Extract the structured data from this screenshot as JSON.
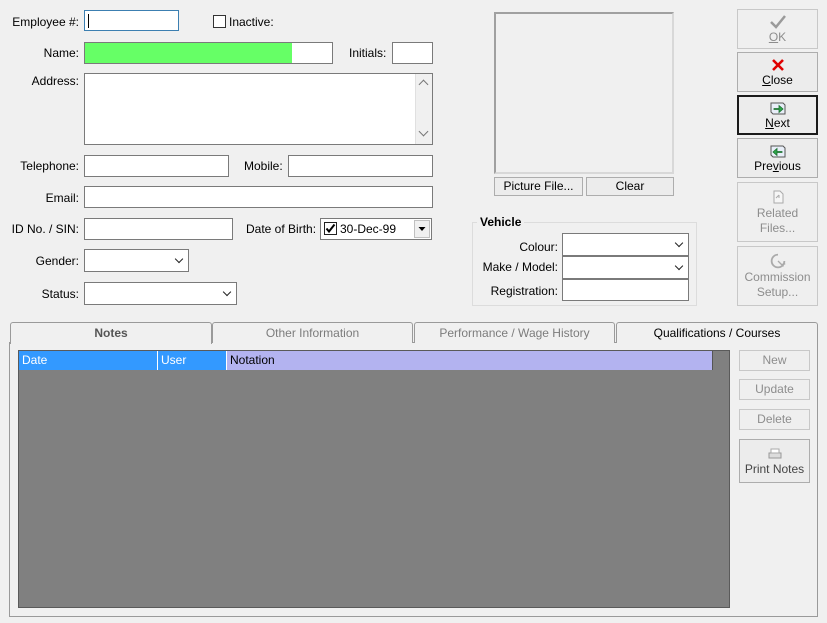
{
  "form": {
    "employee_no_label": "Employee #:",
    "employee_no_value": "",
    "inactive_label": "Inactive:",
    "inactive_checked": false,
    "name_label": "Name:",
    "name_value": "",
    "name_progress": 0.84,
    "initials_label": "Initials:",
    "initials_value": "",
    "address_label": "Address:",
    "address_value": "",
    "telephone_label": "Telephone:",
    "telephone_value": "",
    "mobile_label": "Mobile:",
    "mobile_value": "",
    "email_label": "Email:",
    "email_value": "",
    "id_label": "ID No. / SIN:",
    "id_value": "",
    "dob_label": "Date of Birth:",
    "dob_value": "30-Dec-99",
    "dob_checked": true,
    "gender_label": "Gender:",
    "gender_value": "",
    "status_label": "Status:",
    "status_value": ""
  },
  "picture": {
    "picture_file_label": "Picture File...",
    "clear_label": "Clear"
  },
  "vehicle": {
    "title": "Vehicle",
    "colour_label": "Colour:",
    "colour_value": "",
    "make_label": "Make / Model:",
    "make_value": "",
    "registration_label": "Registration:",
    "registration_value": ""
  },
  "side_buttons": {
    "ok": {
      "pre": "",
      "key": "O",
      "post": "K",
      "icon": "checkmark-icon",
      "enabled": false
    },
    "close": {
      "pre": "",
      "key": "C",
      "post": "lose",
      "icon": "red-x-icon",
      "enabled": true
    },
    "next": {
      "pre": "",
      "key": "N",
      "post": "ext",
      "icon": "next-arrow-icon",
      "enabled": true
    },
    "previous": {
      "pre": "Pre",
      "key": "v",
      "post": "ious",
      "icon": "previous-arrow-icon",
      "enabled": true
    },
    "related_files": {
      "line1": "Related",
      "line2": "Files...",
      "icon": "related-files-icon",
      "enabled": false
    },
    "commission_setup": {
      "line1": "Commission",
      "line2": "Setup...",
      "icon": "commission-icon",
      "enabled": false
    }
  },
  "tabs": [
    {
      "label": "Notes",
      "selected": true
    },
    {
      "label": "Other Information",
      "selected": false
    },
    {
      "label": "Performance / Wage History",
      "selected": false
    },
    {
      "label": "Qualifications / Courses",
      "selected": false
    }
  ],
  "notes_grid": {
    "columns": [
      "Date",
      "User",
      "Notation"
    ],
    "rows": [],
    "colors": {
      "header_blue": "#3399ff",
      "header_lavender": "#b3b3f0",
      "grid_bg": "#808080"
    }
  },
  "notes_buttons": {
    "new_label": "New",
    "update_label": "Update",
    "delete_label": "Delete",
    "print_notes_label": "Print Notes"
  },
  "colors": {
    "name_highlight": "#66ff66",
    "window_bg": "#f0f0f0"
  }
}
